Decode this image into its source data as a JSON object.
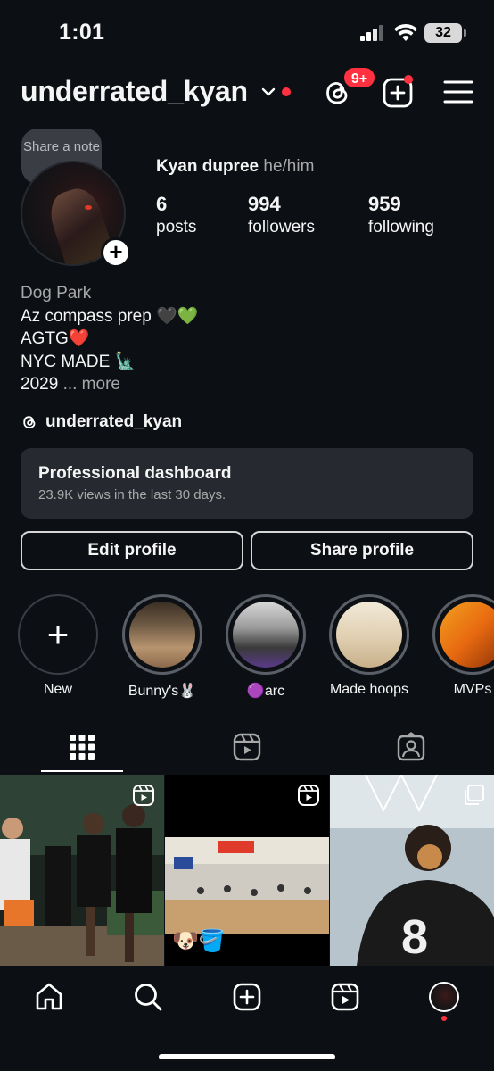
{
  "status_bar": {
    "time": "1:01",
    "battery": "32"
  },
  "header": {
    "username": "underrated_kyan",
    "notification_badge": "9+"
  },
  "profile": {
    "note_label": "Share a note",
    "fullname": "Kyan dupree",
    "pronouns": "he/him",
    "stats": [
      {
        "value": "6",
        "label": "posts"
      },
      {
        "value": "994",
        "label": "followers"
      },
      {
        "value": "959",
        "label": "following"
      }
    ],
    "bio": {
      "category": "Dog Park",
      "lines": [
        "Az compass prep 🖤💚",
        "AGTG❤️",
        "NYC MADE 🗽"
      ],
      "last_line": "2029",
      "more": "... more"
    },
    "threads_handle": "underrated_kyan"
  },
  "dashboard": {
    "title": "Professional dashboard",
    "subtitle": "23.9K views in the last 30 days."
  },
  "buttons": {
    "edit": "Edit profile",
    "share": "Share profile"
  },
  "highlights": [
    {
      "label": "New"
    },
    {
      "label": "Bunny's🐰"
    },
    {
      "label": "🟣arc"
    },
    {
      "label": "Made hoops"
    },
    {
      "label": "MVPs"
    }
  ],
  "posts": [
    {
      "type": "reel"
    },
    {
      "type": "reel",
      "caption": "🐶🪣"
    },
    {
      "type": "carousel"
    }
  ],
  "colors": {
    "background": "#0c1014",
    "badge": "#ff3040",
    "card": "#262a30"
  },
  "icons": [
    "threads-icon",
    "add-post-icon",
    "menu-icon",
    "grid-icon",
    "reels-icon",
    "tagged-icon",
    "home-icon",
    "search-icon",
    "profile-avatar-icon"
  ]
}
